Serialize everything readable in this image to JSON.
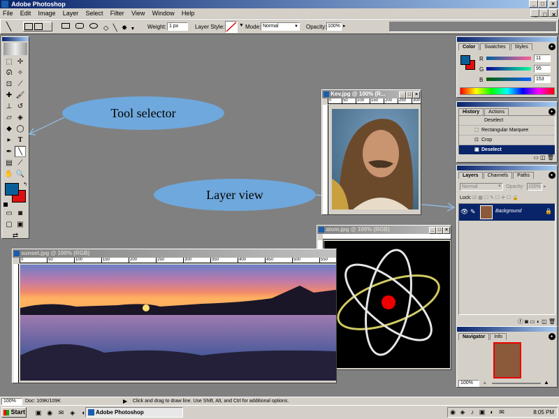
{
  "window": {
    "title": "Adobe Photoshop"
  },
  "menu": [
    "File",
    "Edit",
    "Image",
    "Layer",
    "Select",
    "Filter",
    "View",
    "Window",
    "Help"
  ],
  "options_bar": {
    "weight_label": "Weight:",
    "weight_value": "1 px",
    "layer_style_label": "Layer Style:",
    "mode_label": "Mode:",
    "mode_value": "Normal",
    "opacity_label": "Opacity:",
    "opacity_value": "100%"
  },
  "callouts": {
    "tool_selector": "Tool selector",
    "layer_view": "Layer view"
  },
  "docs": {
    "kev": {
      "title": "Kev.jpg @ 100% (R...",
      "ruler": [
        "0",
        "50",
        "100",
        "150",
        "200",
        "250",
        "300"
      ]
    },
    "atom": {
      "title": "atom.jpg @ 100% (RGB)"
    },
    "sunset": {
      "title": "sunset.jpg @ 100% (RGB)",
      "ruler": [
        "0",
        "50",
        "100",
        "150",
        "200",
        "250",
        "300",
        "350",
        "400",
        "450",
        "500",
        "550"
      ]
    }
  },
  "color_panel": {
    "tabs": [
      "Color",
      "Swatches",
      "Styles"
    ],
    "r_label": "R",
    "r_value": "11",
    "g_label": "G",
    "g_value": "95",
    "b_label": "B",
    "b_value": "153"
  },
  "history_panel": {
    "tabs": [
      "History",
      "Actions"
    ],
    "items": [
      "Deselect",
      "Rectangular Marquee",
      "Crop",
      "Deselect"
    ]
  },
  "layers_panel": {
    "tabs": [
      "Layers",
      "Channels",
      "Paths"
    ],
    "mode_value": "Normal",
    "opacity_label": "Opacity:",
    "opacity_value": "100%",
    "lock_label": "Lock:",
    "layer_name": "Background"
  },
  "navigator_panel": {
    "tabs": [
      "Navigator",
      "Info"
    ],
    "zoom_value": "100%"
  },
  "status_bar": {
    "zoom": "100%",
    "doc_info": "Doc: 109K/109K",
    "hint": "Click and drag to draw line. Use Shift, Alt, and Ctrl for additional options."
  },
  "taskbar": {
    "start_label": "Start",
    "task_label": "Adobe Photoshop",
    "clock": "8:05 PM"
  },
  "colors": {
    "foreground": "#0b5f99",
    "background": "#e01010",
    "desktop": "#808080"
  }
}
